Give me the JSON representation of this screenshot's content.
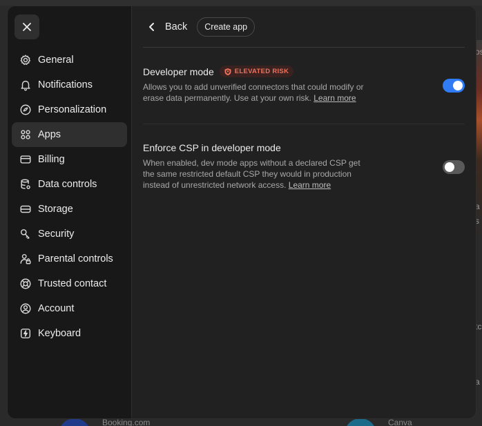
{
  "background": {
    "right_fragments": [
      "os",
      "a",
      "s",
      "tc",
      "a"
    ],
    "bottom_labels": [
      "Booking.com",
      "Canva"
    ]
  },
  "sidebar": {
    "close_icon": "close-icon",
    "items": [
      {
        "label": "General",
        "icon": "gear-icon"
      },
      {
        "label": "Notifications",
        "icon": "bell-icon"
      },
      {
        "label": "Personalization",
        "icon": "personalization-icon"
      },
      {
        "label": "Apps",
        "icon": "apps-grid-icon",
        "active": true
      },
      {
        "label": "Billing",
        "icon": "card-icon"
      },
      {
        "label": "Data controls",
        "icon": "database-icon"
      },
      {
        "label": "Storage",
        "icon": "storage-icon"
      },
      {
        "label": "Security",
        "icon": "key-icon"
      },
      {
        "label": "Parental controls",
        "icon": "parental-icon"
      },
      {
        "label": "Trusted contact",
        "icon": "lifebuoy-icon"
      },
      {
        "label": "Account",
        "icon": "account-icon"
      },
      {
        "label": "Keyboard",
        "icon": "keyboard-icon"
      }
    ]
  },
  "header": {
    "back_label": "Back",
    "create_app_label": "Create app"
  },
  "settings": {
    "developer_mode": {
      "title": "Developer mode",
      "badge": "ELEVATED RISK",
      "description": "Allows you to add unverified connectors that could modify or erase data permanently. Use at your own risk.",
      "link": "Learn more",
      "enabled": true
    },
    "enforce_csp": {
      "title": "Enforce CSP in developer mode",
      "description": "When enabled, dev mode apps without a declared CSP get the same restricted default CSP they would in production instead of unrestricted network access.",
      "link": "Learn more",
      "enabled": false
    }
  },
  "colors": {
    "accent": "#2f7cf6",
    "risk": "#f0715c",
    "modal_bg": "#212121",
    "sidebar_bg": "#181818"
  }
}
